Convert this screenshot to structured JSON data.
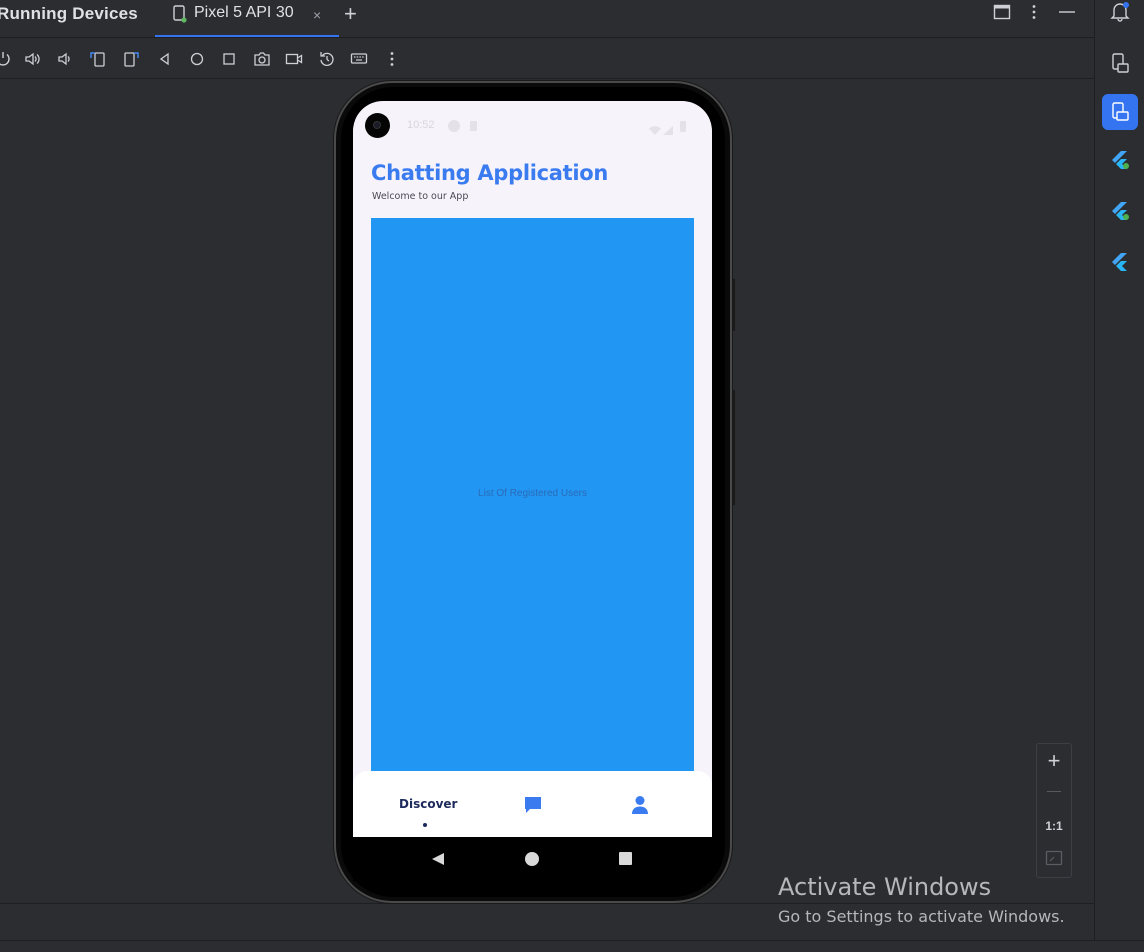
{
  "window": {
    "panel_title": "Running Devices",
    "tab_label": "Pixel 5 API 30",
    "tab_close": "×",
    "add_tab": "+"
  },
  "toolbar": {
    "icons": [
      "power-icon",
      "volume-up-icon",
      "volume-down-icon",
      "rotate-left-icon",
      "rotate-right-icon",
      "back-icon",
      "home-icon",
      "overview-icon",
      "screenshot-icon",
      "screen-record-icon",
      "reset-icon",
      "keyboard-icon",
      "more-options-icon"
    ]
  },
  "app": {
    "status_time": "10:52",
    "title": "Chatting Application",
    "subtitle": "Welcome to our App",
    "panel_text": "List Of Registered Users",
    "nav_discover": "Discover"
  },
  "zoom": {
    "plus": "+",
    "minus": "—",
    "actual": "1:1"
  },
  "watermark": {
    "line1": "Activate Windows",
    "line2": "Go to Settings to activate Windows."
  },
  "colors": {
    "accent": "#3574f0",
    "app_title": "#3a7bf0",
    "panel_blue": "#2196f3"
  }
}
